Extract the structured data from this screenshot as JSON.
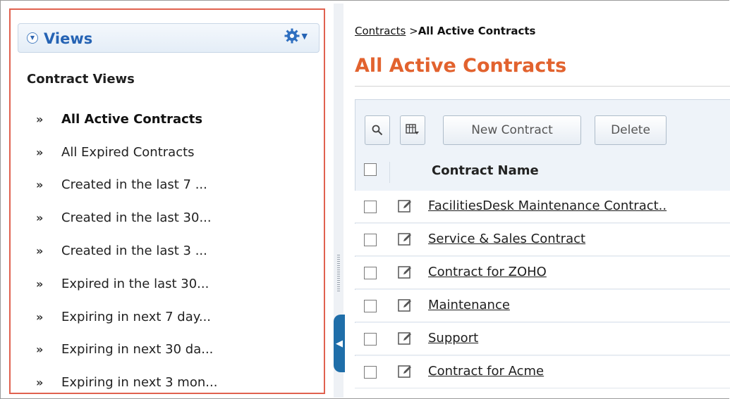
{
  "views_panel": {
    "title": "Views",
    "section_title": "Contract Views",
    "items": [
      {
        "label": "All Active Contracts",
        "active": true
      },
      {
        "label": "All Expired Contracts",
        "active": false
      },
      {
        "label": "Created in the last 7 ...",
        "active": false
      },
      {
        "label": "Created in the last 30...",
        "active": false
      },
      {
        "label": "Created in the last 3 ...",
        "active": false
      },
      {
        "label": "Expired in the last 30...",
        "active": false
      },
      {
        "label": "Expiring in next 7 day...",
        "active": false
      },
      {
        "label": "Expiring in next 30 da...",
        "active": false
      },
      {
        "label": "Expiring in next 3 mon...",
        "active": false
      }
    ],
    "item_bullet": "»",
    "icons": {
      "collapse": "chevron-down-icon",
      "settings": "gear-icon"
    }
  },
  "breadcrumb": {
    "parent": "Contracts",
    "separator": ">",
    "current": "All Active Contracts"
  },
  "page_title": "All Active Contracts",
  "toolbar": {
    "search_icon": "search-icon",
    "columns_icon": "column-chooser-icon",
    "new_label": "New Contract",
    "delete_label": "Delete"
  },
  "table": {
    "column_header": "Contract Name",
    "rows": [
      {
        "name": "FacilitiesDesk Maintenance Contract.."
      },
      {
        "name": "Service & Sales Contract"
      },
      {
        "name": "Contract for ZOHO"
      },
      {
        "name": "Maintenance"
      },
      {
        "name": "Support"
      },
      {
        "name": "Contract for Acme"
      }
    ]
  },
  "colors": {
    "accent": "#e2622e",
    "panel_highlight": "#e0614f",
    "views_title": "#2563b4",
    "splitter_handle": "#1f6ea9"
  }
}
